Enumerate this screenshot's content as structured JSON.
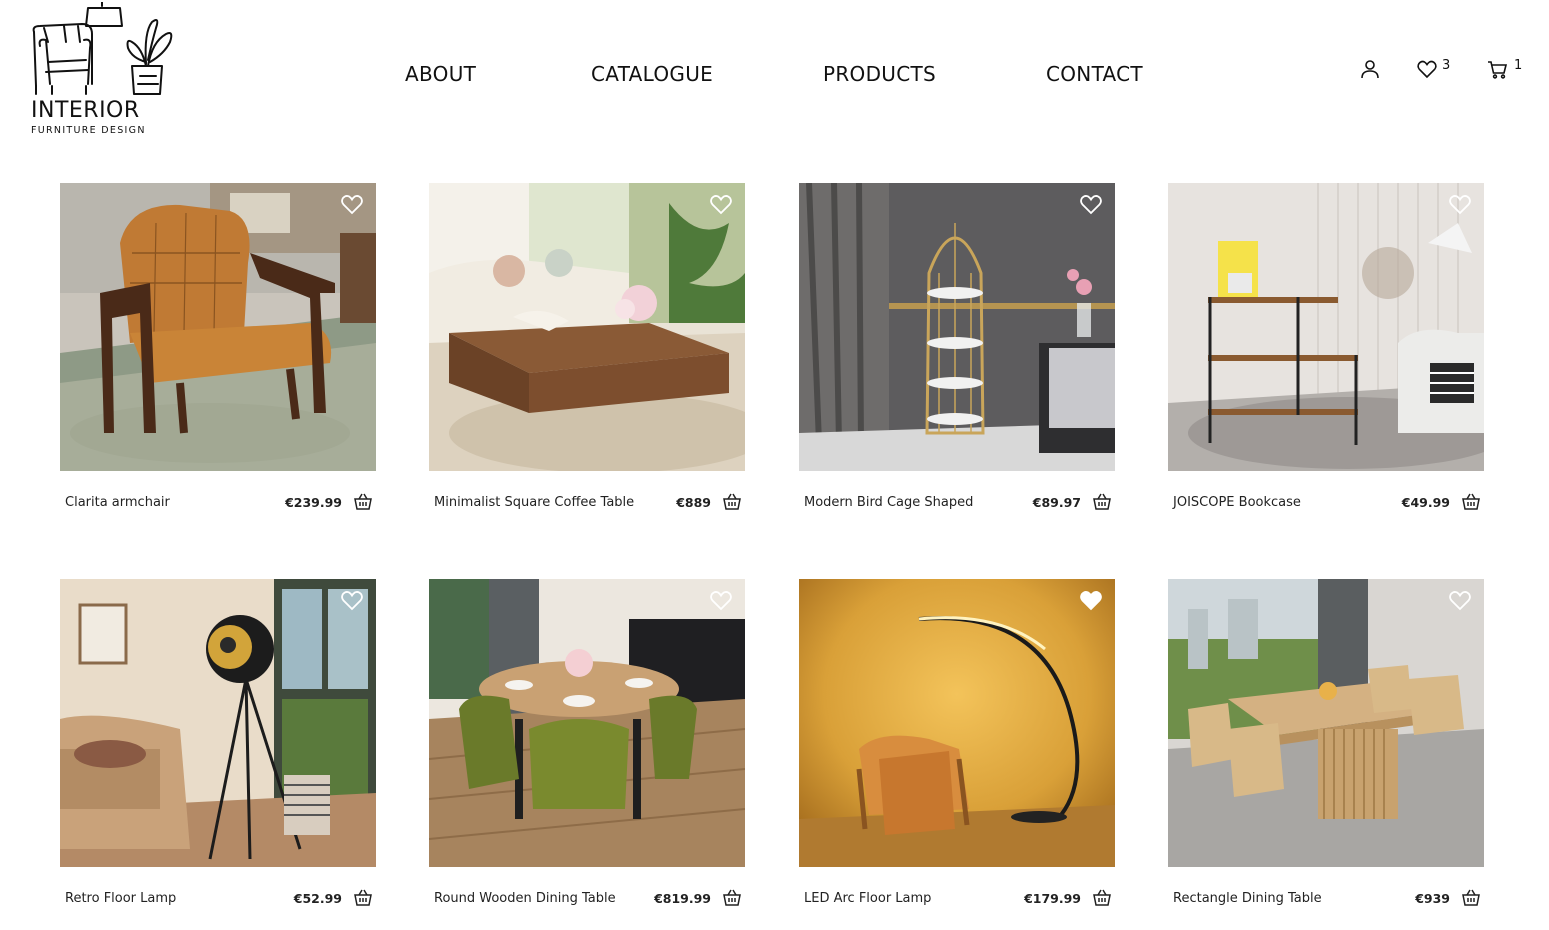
{
  "brand": {
    "title": "INTERIOR",
    "subtitle": "FURNITURE DESIGN"
  },
  "nav": {
    "items": [
      {
        "label": "ABOUT"
      },
      {
        "label": "CATALOGUE"
      },
      {
        "label": "PRODUCTS"
      },
      {
        "label": "CONTACT"
      }
    ]
  },
  "header": {
    "icons": {
      "account": "user-icon",
      "wishlist": "heart-icon",
      "cart": "cart-icon"
    },
    "wishlist_count": "3",
    "cart_count": "1"
  },
  "products": [
    {
      "name": "Clarita armchair",
      "price": "€239.99",
      "favorited": false
    },
    {
      "name": "Minimalist Square Coffee Table",
      "price": "€889",
      "favorited": false
    },
    {
      "name": "Modern Bird Cage Shaped",
      "price": "€89.97",
      "favorited": false
    },
    {
      "name": "JOISCOPE Bookcase",
      "price": "€49.99",
      "favorited": false
    },
    {
      "name": "Retro Floor Lamp",
      "price": "€52.99",
      "favorited": false
    },
    {
      "name": "Round Wooden Dining Table",
      "price": "€819.99",
      "favorited": false
    },
    {
      "name": "LED Arc Floor Lamp",
      "price": "€179.99",
      "favorited": true
    },
    {
      "name": "Rectangle Dining Table",
      "price": "€939",
      "favorited": false
    }
  ],
  "colors": {
    "text": "#111111",
    "background": "#ffffff"
  }
}
